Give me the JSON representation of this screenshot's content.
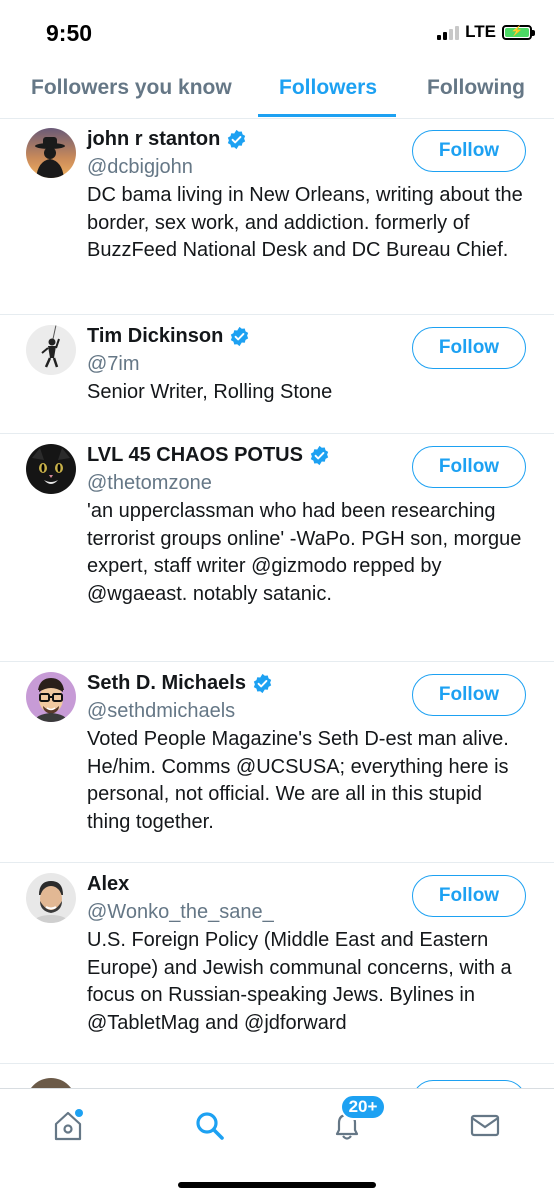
{
  "status_bar": {
    "time": "9:50",
    "network": "LTE"
  },
  "tabs": [
    {
      "label": "Followers you know",
      "active": false
    },
    {
      "label": "Followers",
      "active": true
    },
    {
      "label": "Following",
      "active": false
    }
  ],
  "users": [
    {
      "name": "john r stanton",
      "handle": "@dcbigjohn",
      "verified": true,
      "bio": "DC bama living in New Orleans, writing about the border, sex work, and addiction. formerly of BuzzFeed National Desk and DC Bureau Chief.",
      "follow_label": "Follow"
    },
    {
      "name": "Tim Dickinson",
      "handle": "@7im",
      "verified": true,
      "bio": "Senior Writer, Rolling Stone",
      "follow_label": "Follow"
    },
    {
      "name": "LVL 45 CHAOS POTUS",
      "handle": "@thetomzone",
      "verified": true,
      "bio": "'an upperclassman who had been researching terrorist groups online' -WaPo. PGH son, morgue expert, staff writer @gizmodo repped by @wgaeast. notably satanic.",
      "follow_label": "Follow"
    },
    {
      "name": "Seth D. Michaels",
      "handle": "@sethdmichaels",
      "verified": true,
      "bio": "Voted People Magazine's Seth D-est man alive. He/him. Comms @UCSUSA; everything here is personal, not official. We are all in this stupid thing together.",
      "follow_label": "Follow"
    },
    {
      "name": "Alex",
      "handle": "@Wonko_the_sane_",
      "verified": false,
      "bio": "U.S. Foreign Policy (Middle East and Eastern Europe) and Jewish communal concerns, with a focus on Russian-speaking Jews. Bylines in @TabletMag and @jdforward",
      "follow_label": "Follow"
    }
  ],
  "bottom_nav": {
    "items": [
      "home-icon",
      "search-icon",
      "notifications-icon",
      "messages-icon"
    ],
    "notifications_badge": "20+"
  },
  "colors": {
    "accent": "#1da1f2",
    "secondary_text": "#657786",
    "divider": "#e6ecf0"
  }
}
